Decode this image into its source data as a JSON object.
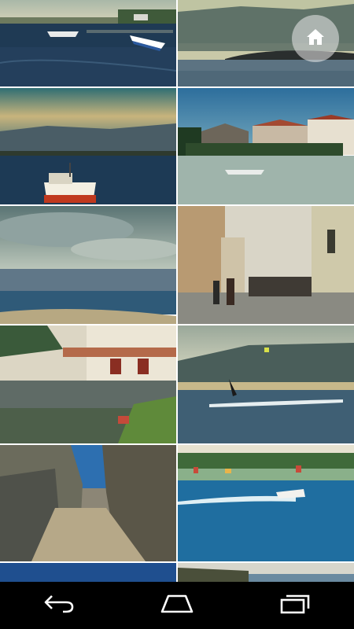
{
  "gallery": {
    "photos": [
      {
        "subject": "harbor-boats"
      },
      {
        "subject": "coast-mountains"
      },
      {
        "subject": "boat-sunset"
      },
      {
        "subject": "village-waterfront"
      },
      {
        "subject": "kitesurf-beach"
      },
      {
        "subject": "street-people"
      },
      {
        "subject": "cafe-terrace"
      },
      {
        "subject": "kitesurfer"
      },
      {
        "subject": "stone-alley"
      },
      {
        "subject": "jetski"
      },
      {
        "subject": "partial-bottom-left"
      },
      {
        "subject": "partial-bottom-right"
      }
    ]
  },
  "icons": {
    "home": "home-icon",
    "back": "back-icon",
    "home_nav": "home-nav-icon",
    "recents": "recent-apps-icon"
  },
  "colors": {
    "nav_bar": "#000000",
    "home_button_bg": "#ebebeb"
  }
}
